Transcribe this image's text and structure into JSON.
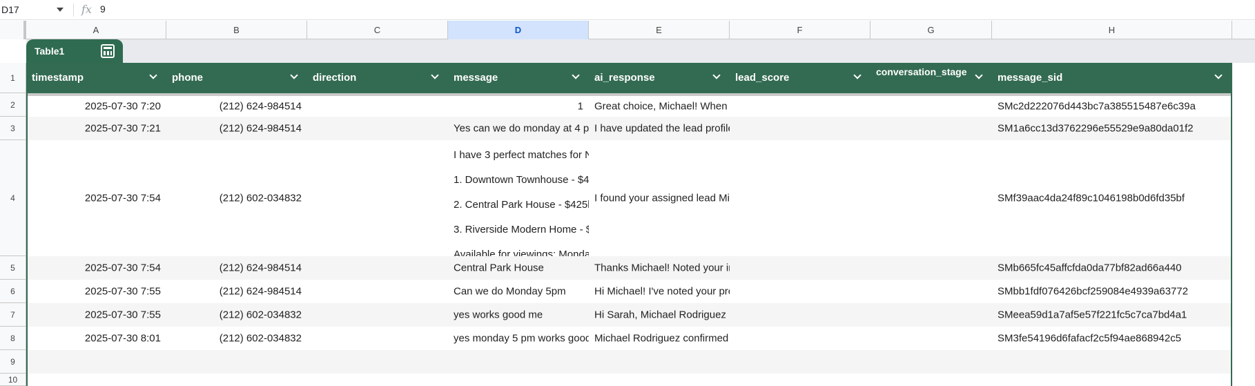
{
  "formula_bar": {
    "cell_ref": "D17",
    "fx_icon": "fx-icon",
    "value": "9"
  },
  "columns": [
    "A",
    "B",
    "C",
    "D",
    "E",
    "F",
    "G",
    "H"
  ],
  "row_numbers": [
    "1",
    "2",
    "3",
    "4",
    "5",
    "6",
    "7",
    "8",
    "9",
    "10"
  ],
  "table": {
    "name": "Table1",
    "headers": [
      "timestamp",
      "phone",
      "direction",
      "message",
      "ai_response",
      "lead_score",
      "conversation_stage",
      "message_sid"
    ],
    "rows": [
      {
        "timestamp": "2025-07-30 7:20",
        "phone": "(212) 624-984514",
        "direction": "",
        "message": "1",
        "ai_response": "Great choice, Michael! When v",
        "lead_score": "",
        "conversation_stage": "",
        "message_sid": "SMc2d222076d443bc7a385515487e6c39a"
      },
      {
        "timestamp": "2025-07-30 7:21",
        "phone": "(212) 624-984514",
        "direction": "",
        "message": "Yes can we do monday at 4 p",
        "ai_response": "I have updated the lead profile",
        "lead_score": "",
        "conversation_stage": "",
        "message_sid": "SM1a6cc13d3762296e55529e9a80da01f2"
      },
      {
        "timestamp": "2025-07-30 7:54",
        "phone": "(212) 602-034832",
        "direction": "",
        "message_lines": [
          "I have 3 perfect matches for N",
          "1. Downtown Townhouse - $4",
          "2. Central Park House - $425k",
          "3. Riverside Modern Home - $",
          "Available for viewings: Monda"
        ],
        "ai_response": "I found your assigned lead Mi",
        "lead_score": "",
        "conversation_stage": "",
        "message_sid": "SMf39aac4da24f89c1046198b0d6fd35bf"
      },
      {
        "timestamp": "2025-07-30 7:54",
        "phone": "(212) 624-984514",
        "direction": "",
        "message": "Central Park House",
        "ai_response": "Thanks Michael! Noted your in",
        "lead_score": "",
        "conversation_stage": "",
        "message_sid": "SMb665fc45affcfda0da77bf82ad66a440"
      },
      {
        "timestamp": "2025-07-30 7:55",
        "phone": "(212) 624-984514",
        "direction": "",
        "message": "Can we do Monday 5pm",
        "ai_response": "Hi Michael! I've noted your pre",
        "lead_score": "",
        "conversation_stage": "",
        "message_sid": "SMbb1fdf076426bcf259084e4939a63772"
      },
      {
        "timestamp": "2025-07-30 7:55",
        "phone": "(212) 602-034832",
        "direction": "",
        "message": "yes works good me",
        "ai_response": "Hi Sarah, Michael Rodriguez i",
        "lead_score": "",
        "conversation_stage": "",
        "message_sid": "SMeea59d1a7af5e57f221fc5c7ca7bd4a1"
      },
      {
        "timestamp": "2025-07-30 8:01",
        "phone": "(212) 602-034832",
        "direction": "",
        "message": "yes monday 5 pm works good",
        "ai_response": "Michael Rodriguez confirmed",
        "lead_score": "",
        "conversation_stage": "",
        "message_sid": "SM3fe54196d6fafacf2c5f94ae868942c5"
      }
    ]
  },
  "colors": {
    "table_header": "#336b52",
    "selected_column": "#d3e3fd"
  }
}
